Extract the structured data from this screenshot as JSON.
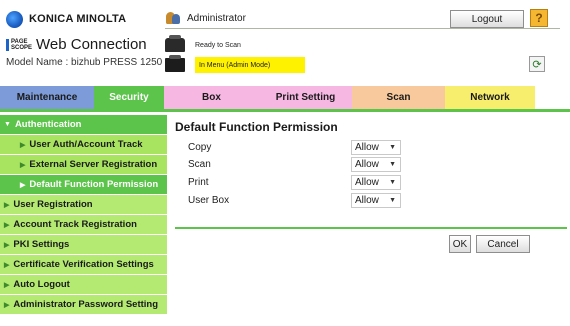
{
  "header": {
    "brand": "KONICA MINOLTA",
    "wc_logo_mini": "PAGE SCOPE",
    "wc_title": "Web Connection",
    "model": "Model Name : bizhub PRESS 1250",
    "user_label": "Administrator",
    "logout_label": "Logout",
    "help_label": "?",
    "status_ready": "Ready to Scan",
    "status_mode": "In Menu (Admin Mode)",
    "refresh_icon": "refresh-icon",
    "refresh_glyph": "⟳"
  },
  "tabs": [
    {
      "label": "Maintenance"
    },
    {
      "label": "Security"
    },
    {
      "label": "Box"
    },
    {
      "label": "Print Setting"
    },
    {
      "label": "Scan"
    },
    {
      "label": "Network"
    }
  ],
  "sidebar": {
    "items": [
      {
        "label": "Authentication",
        "arrow": "▼"
      },
      {
        "label": "User Auth/Account Track",
        "arrow": "▶"
      },
      {
        "label": "External Server Registration",
        "arrow": "▶"
      },
      {
        "label": "Default Function Permission",
        "arrow": "▶"
      },
      {
        "label": "User Registration",
        "arrow": "▶"
      },
      {
        "label": "Account Track Registration",
        "arrow": "▶"
      },
      {
        "label": "PKI Settings",
        "arrow": "▶"
      },
      {
        "label": "Certificate Verification Settings",
        "arrow": "▶"
      },
      {
        "label": "Auto Logout",
        "arrow": "▶"
      },
      {
        "label": "Administrator Password Setting",
        "arrow": "▶"
      }
    ]
  },
  "main": {
    "title": "Default Function Permission",
    "rows": [
      {
        "label": "Copy",
        "value": "Allow"
      },
      {
        "label": "Scan",
        "value": "Allow"
      },
      {
        "label": "Print",
        "value": "Allow"
      },
      {
        "label": "User Box",
        "value": "Allow"
      }
    ],
    "ok_label": "OK",
    "cancel_label": "Cancel",
    "select_caret": "▼"
  },
  "colors": {
    "accent_green": "#5dc44b",
    "sidebar_green": "#b4ea72",
    "status_highlight": "#fff200"
  }
}
